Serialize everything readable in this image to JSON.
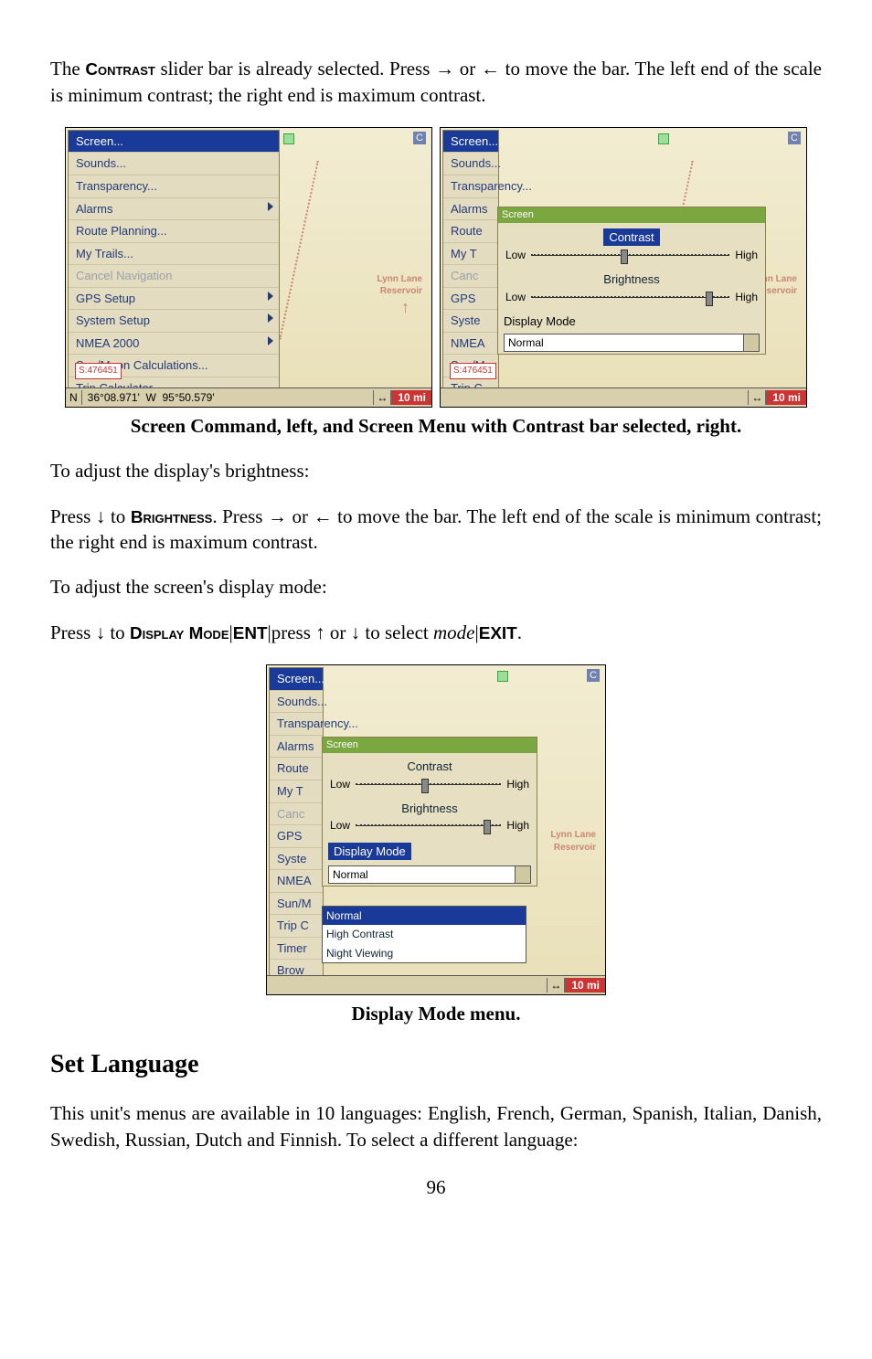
{
  "para": {
    "intro1": "The ",
    "intro_sc": "Contrast",
    "intro2": " slider bar is already selected. Press → or ← to move the bar. The left end of the scale is minimum contrast; the right end is maximum contrast."
  },
  "left_menu": {
    "items": [
      {
        "label": "Screen...",
        "sel": true
      },
      {
        "label": "Sounds..."
      },
      {
        "label": "Transparency..."
      },
      {
        "label": "Alarms",
        "sub": true
      },
      {
        "label": "Route Planning..."
      },
      {
        "label": "My Trails..."
      },
      {
        "label": "Cancel Navigation",
        "dis": true
      },
      {
        "label": "GPS Setup",
        "sub": true
      },
      {
        "label": "System Setup",
        "sub": true
      },
      {
        "label": "NMEA 2000",
        "sub": true
      },
      {
        "label": "Sun/Moon Calculations..."
      },
      {
        "label": "Trip Calculator..."
      },
      {
        "label": "Timers",
        "sub": true
      },
      {
        "label": "Browse Files..."
      }
    ],
    "highway": "S:476451",
    "coords_n": "N",
    "coords": "36°08.971'",
    "coords_w": "W",
    "coords_lon": "95°50.579'",
    "zoom": "10 mi"
  },
  "right_short_menu": {
    "items": [
      "Screen...",
      "Sounds...",
      "Transparency...",
      "Alarms",
      "Route",
      "My T",
      "Canc",
      "GPS",
      "Syste",
      "NMEA",
      "Sun/M",
      "Trip C",
      "Timer",
      "Brow"
    ],
    "highway": "S:476451"
  },
  "popup": {
    "title_bar": "Screen",
    "contrast_title": "Contrast",
    "brightness_title": "Brightness",
    "low": "Low",
    "high": "High",
    "display_mode_label": "Display Mode",
    "mode_value": "Normal",
    "mode_options": [
      "Normal",
      "High Contrast",
      "Night Viewing"
    ]
  },
  "map_labels": {
    "c": "C",
    "reservoir": "Lynn Lane\nReservoir",
    "north": "↑"
  },
  "caption1": "Screen Command, left, and Screen Menu with Contrast bar selected, right.",
  "brightness": {
    "lead": "To adjust the display's brightness:",
    "p1a": "Press ↓ to ",
    "p1sc": "Brightness",
    "p1b": ". Press → or ← to move the bar. The left end of the scale is minimum contrast; the right end is maximum contrast."
  },
  "displaymode": {
    "lead": "To adjust the screen's display mode:",
    "p1a": "Press ↓ to ",
    "p1sc": "Display Mode",
    "p1b": "|",
    "p1ent": "ENT",
    "p1c": "|press ↑ or ↓ to select ",
    "p1mode": "mode",
    "p1d": "|",
    "p1exit": "EXIT",
    "p1e": "."
  },
  "caption2": "Display Mode menu.",
  "lang": {
    "heading": "Set Language",
    "body": "This unit's menus are available in 10 languages: English, French, German, Spanish, Italian, Danish, Swedish, Russian, Dutch and Finnish. To select a different language:"
  },
  "pagenum": "96"
}
